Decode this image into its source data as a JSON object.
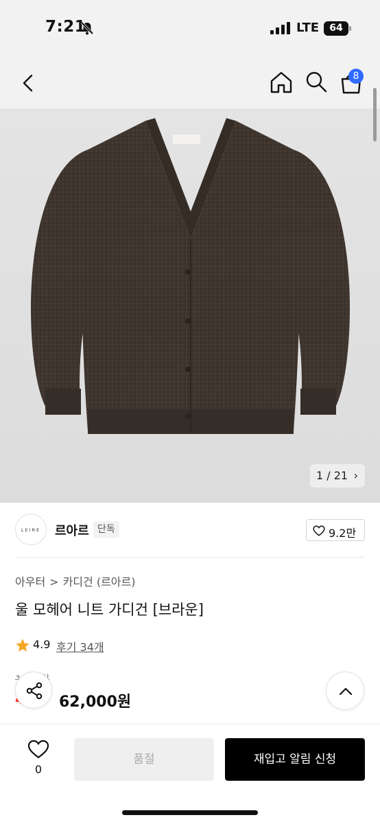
{
  "status_bar": {
    "time": "7:21",
    "network": "LTE",
    "battery": "64"
  },
  "nav": {
    "cart_badge": "8",
    "icons": [
      "back-icon",
      "home-icon",
      "search-icon",
      "cart-icon"
    ]
  },
  "gallery": {
    "counter": "1 / 21",
    "counter_chevron": "›"
  },
  "brand": {
    "logo_text": "LEIRE",
    "name": "르아르",
    "tag": "단독",
    "like_count": "9.2만"
  },
  "product": {
    "breadcrumb": [
      "아우터",
      "카디건 (르아르)"
    ],
    "breadcrumb_separator": ">",
    "title": "울 모헤어 니트 가디건 [브라운]",
    "rating": "4.9",
    "review_link": "후기 34개",
    "original_price_visible": "1 00원",
    "discount_visible": "4",
    "sale_price": "62,000원"
  },
  "bottom_bar": {
    "wish_count": "0",
    "soldout_label": "품절",
    "restock_label": "재입고 알림 신청"
  },
  "colors": {
    "accent_blue": "#2f6bff",
    "discount_red": "#ff3b30",
    "star_orange": "#f5a623",
    "sweater_brown": "#3e342d"
  }
}
